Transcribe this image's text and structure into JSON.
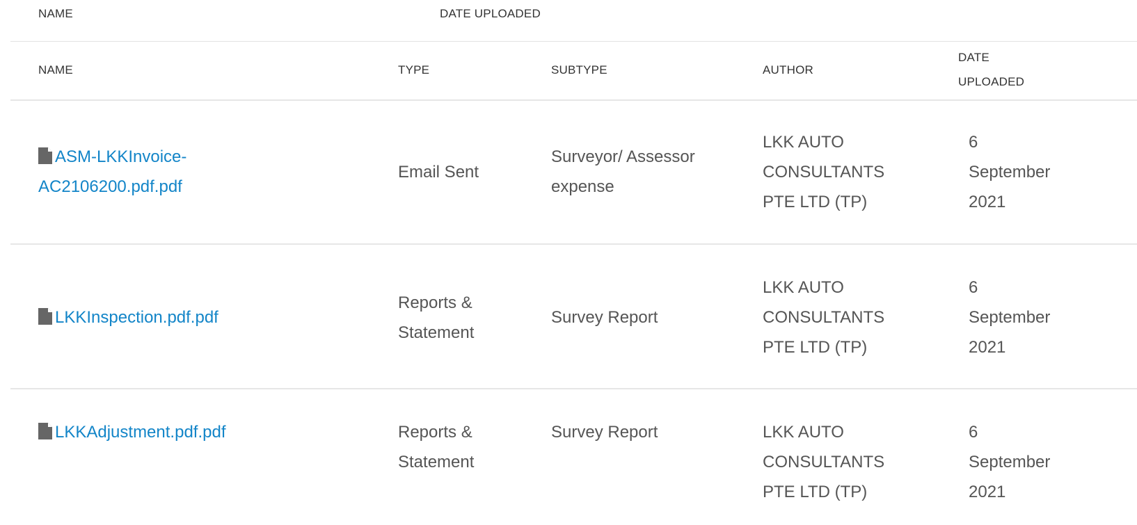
{
  "collapsed_header": {
    "name": "NAME",
    "date_uploaded": "DATE UPLOADED"
  },
  "columns": {
    "name": "NAME",
    "type": "TYPE",
    "subtype": "SUBTYPE",
    "author": "AUTHOR",
    "date_line1": "DATE",
    "date_line2": "UPLOADED"
  },
  "icons": {
    "file": "file-icon"
  },
  "colors": {
    "link": "#1385c8",
    "text": "#555555",
    "icon": "#666666"
  },
  "rows": [
    {
      "name_line1": "ASM-LKKInvoice-",
      "name_line2": "AC2106200.pdf.pdf",
      "type_line1": "Email Sent",
      "type_line2": "",
      "subtype_line1": "Surveyor/ Assessor",
      "subtype_line2": "expense",
      "author_line1": "LKK AUTO",
      "author_line2": "CONSULTANTS",
      "author_line3": "PTE LTD (TP)",
      "date_line1": "6",
      "date_line2": "September",
      "date_line3": "2021"
    },
    {
      "name_line1": "LKKInspection.pdf.pdf",
      "name_line2": "",
      "type_line1": "Reports &",
      "type_line2": "Statement",
      "subtype_line1": "Survey Report",
      "subtype_line2": "",
      "author_line1": "LKK AUTO",
      "author_line2": "CONSULTANTS",
      "author_line3": "PTE LTD (TP)",
      "date_line1": "6",
      "date_line2": "September",
      "date_line3": "2021"
    },
    {
      "name_line1": "LKKAdjustment.pdf.pdf",
      "name_line2": "",
      "type_line1": "Reports &",
      "type_line2": "Statement",
      "subtype_line1": "Survey Report",
      "subtype_line2": "",
      "author_line1": "LKK AUTO",
      "author_line2": "CONSULTANTS",
      "author_line3": "PTE LTD (TP)",
      "date_line1": "6",
      "date_line2": "September",
      "date_line3": "2021"
    }
  ]
}
